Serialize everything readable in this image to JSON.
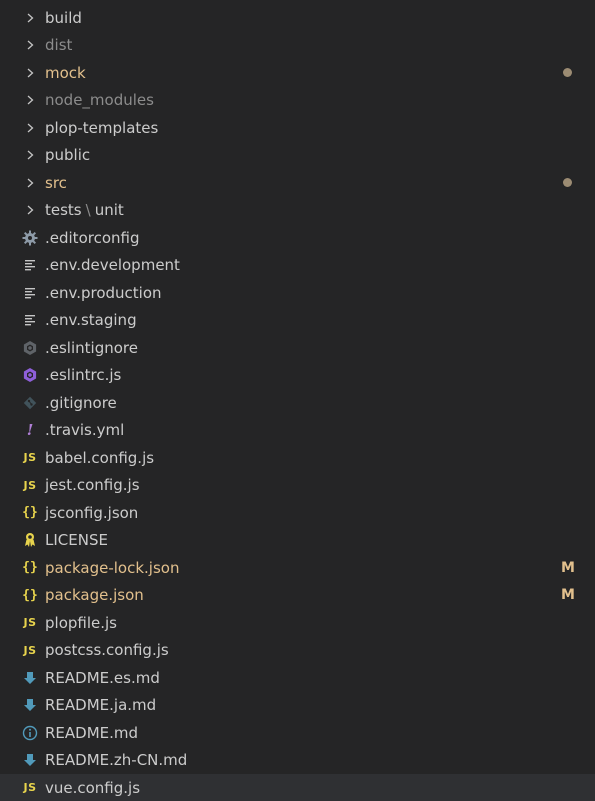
{
  "explorer": {
    "items": [
      {
        "label": "build",
        "kind": "folder",
        "tone": "default",
        "status": ""
      },
      {
        "label": "dist",
        "kind": "folder",
        "tone": "ignored",
        "status": ""
      },
      {
        "label": "mock",
        "kind": "folder",
        "tone": "modified",
        "status": "dot"
      },
      {
        "label": "node_modules",
        "kind": "folder",
        "tone": "ignored",
        "status": ""
      },
      {
        "label": "plop-templates",
        "kind": "folder",
        "tone": "default",
        "status": ""
      },
      {
        "label": "public",
        "kind": "folder",
        "tone": "default",
        "status": ""
      },
      {
        "label": "src",
        "kind": "folder",
        "tone": "modified",
        "status": "dot"
      },
      {
        "label_parts": [
          "tests",
          "\\",
          "unit"
        ],
        "kind": "folder-compact",
        "tone": "default",
        "status": ""
      },
      {
        "label": ".editorconfig",
        "kind": "gear-icon",
        "tone": "default",
        "status": ""
      },
      {
        "label": ".env.development",
        "kind": "lines-icon",
        "tone": "default",
        "status": ""
      },
      {
        "label": ".env.production",
        "kind": "lines-icon",
        "tone": "default",
        "status": ""
      },
      {
        "label": ".env.staging",
        "kind": "lines-icon",
        "tone": "default",
        "status": ""
      },
      {
        "label": ".eslintignore",
        "kind": "eslint-gray-icon",
        "tone": "default",
        "status": ""
      },
      {
        "label": ".eslintrc.js",
        "kind": "eslint-purple-icon",
        "tone": "default",
        "status": ""
      },
      {
        "label": ".gitignore",
        "kind": "git-icon",
        "tone": "default",
        "status": ""
      },
      {
        "label": ".travis.yml",
        "kind": "exclamation-icon",
        "tone": "default",
        "status": ""
      },
      {
        "label": "babel.config.js",
        "kind": "js-icon",
        "tone": "default",
        "status": ""
      },
      {
        "label": "jest.config.js",
        "kind": "js-icon",
        "tone": "default",
        "status": ""
      },
      {
        "label": "jsconfig.json",
        "kind": "json-icon",
        "tone": "default",
        "status": ""
      },
      {
        "label": "LICENSE",
        "kind": "license-icon",
        "tone": "default",
        "status": ""
      },
      {
        "label": "package-lock.json",
        "kind": "json-icon",
        "tone": "modified",
        "status": "M"
      },
      {
        "label": "package.json",
        "kind": "json-icon",
        "tone": "modified",
        "status": "M"
      },
      {
        "label": "plopfile.js",
        "kind": "js-icon",
        "tone": "default",
        "status": ""
      },
      {
        "label": "postcss.config.js",
        "kind": "js-icon",
        "tone": "default",
        "status": ""
      },
      {
        "label": "README.es.md",
        "kind": "download-arrow-icon",
        "tone": "default",
        "status": ""
      },
      {
        "label": "README.ja.md",
        "kind": "download-arrow-icon",
        "tone": "default",
        "status": ""
      },
      {
        "label": "README.md",
        "kind": "info-icon",
        "tone": "default",
        "status": ""
      },
      {
        "label": "README.zh-CN.md",
        "kind": "download-arrow-icon",
        "tone": "default",
        "status": ""
      },
      {
        "label": "vue.config.js",
        "kind": "js-icon",
        "tone": "default",
        "status": "",
        "selected": true
      }
    ],
    "icon_glyphs": {
      "js": "JS",
      "json": "{}",
      "exclamation": "!"
    },
    "colors": {
      "background": "#252526",
      "text_default": "#cccccc",
      "text_ignored": "#8c8c8c",
      "text_modified": "#e2c08d",
      "js_yellow": "#e8d44d",
      "eslint_purple": "#8e5fd9",
      "markdown_blue": "#519aba",
      "selected_row": "#2f3033"
    }
  }
}
